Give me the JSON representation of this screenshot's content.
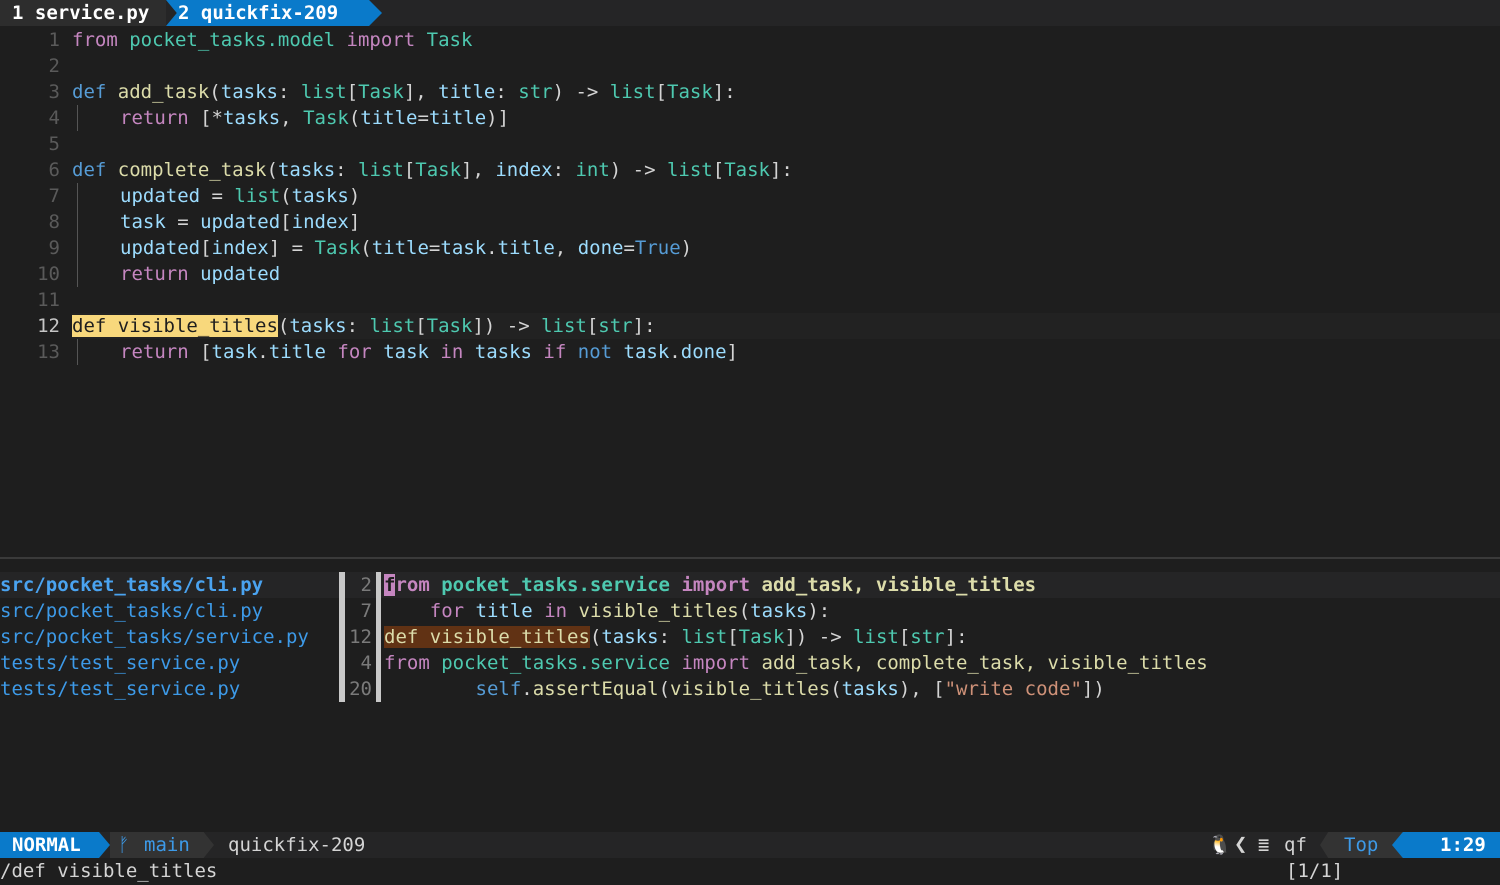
{
  "tabline": {
    "tab1": "1 service.py",
    "tab2": "2 quickfix-209"
  },
  "editor": {
    "lines": [
      {
        "n": "1"
      },
      {
        "n": "2"
      },
      {
        "n": "3"
      },
      {
        "n": "4"
      },
      {
        "n": "5"
      },
      {
        "n": "6"
      },
      {
        "n": "7"
      },
      {
        "n": "8"
      },
      {
        "n": "9"
      },
      {
        "n": "10"
      },
      {
        "n": "11"
      },
      {
        "n": "12"
      },
      {
        "n": "13"
      }
    ],
    "code": {
      "l1": [
        "from",
        " pocket_tasks.model ",
        "import",
        " Task"
      ],
      "l3": [
        "def",
        " ",
        "add_task",
        "(",
        "tasks",
        ": ",
        "list",
        "[",
        "Task",
        "], ",
        "title",
        ": ",
        "str",
        ") -> ",
        "list",
        "[",
        "Task",
        "]:"
      ],
      "l4": [
        "return",
        " [*",
        "tasks",
        ", ",
        "Task",
        "(",
        "title",
        "=",
        "title",
        ")]"
      ],
      "l6": [
        "def",
        " ",
        "complete_task",
        "(",
        "tasks",
        ": ",
        "list",
        "[",
        "Task",
        "], ",
        "index",
        ": ",
        "int",
        ") -> ",
        "list",
        "[",
        "Task",
        "]:"
      ],
      "l7": [
        "updated",
        " = ",
        "list",
        "(",
        "tasks",
        ")"
      ],
      "l8": [
        "task",
        " = ",
        "updated",
        "[",
        "index",
        "]"
      ],
      "l9": [
        "updated",
        "[",
        "index",
        "] = ",
        "Task",
        "(",
        "title",
        "=",
        "task",
        ".",
        "title",
        ", ",
        "done",
        "=",
        "True",
        ")"
      ],
      "l10": [
        "return",
        " ",
        "updated"
      ],
      "l12": [
        "def visible_titles",
        "(",
        "tasks",
        ": ",
        "list",
        "[",
        "Task",
        "]) -> ",
        "list",
        "[",
        "str",
        "]:"
      ],
      "l13": [
        "return",
        " [",
        "task",
        ".",
        "title",
        " ",
        "for",
        " ",
        "task",
        " ",
        "in",
        " ",
        "tasks",
        " ",
        "if",
        " ",
        "not",
        " ",
        "task",
        ".",
        "done",
        "]"
      ]
    }
  },
  "quickfix": {
    "files": [
      "src/pocket_tasks/cli.py",
      "src/pocket_tasks/cli.py",
      "src/pocket_tasks/service.py",
      "tests/test_service.py",
      "tests/test_service.py"
    ],
    "lnums": [
      "2",
      "7",
      "12",
      "4",
      "20"
    ],
    "r1": [
      "f",
      "rom",
      " pocket_tasks.service ",
      "import",
      " add_task, visible_titles"
    ],
    "r2": [
      "    ",
      "for",
      " ",
      "title",
      " ",
      "in",
      " ",
      "visible_titles",
      "(",
      "tasks",
      "):"
    ],
    "r3": [
      "def visible_titles",
      "(",
      "tasks",
      ": ",
      "list",
      "[",
      "Task",
      "]) -> ",
      "list",
      "[",
      "str",
      "]:"
    ],
    "r4": [
      "from",
      " pocket_tasks.service ",
      "import",
      " add_task, complete_task, visible_titles"
    ],
    "r5": [
      "        ",
      "self",
      ".",
      "assertEqual",
      "(",
      "visible_titles",
      "(",
      "tasks",
      "), [",
      "\"write code\"",
      "])"
    ]
  },
  "statusline": {
    "mode": "NORMAL",
    "branch_icon": "ᚠ",
    "branch": "main",
    "buffer": "quickfix-209",
    "os_icon": "🐧",
    "separator": "❮",
    "lines_icon": "≣",
    "filetype": "qf",
    "scroll": "Top",
    "position": "1:29"
  },
  "cmdline": {
    "command": "/def visible_titles",
    "match_count": "[1/1]"
  },
  "colors": {
    "accent": "#0a7aca",
    "background": "#1e1e1e",
    "search_highlight": "#f8d87c",
    "file_link": "#3d9ae8"
  }
}
